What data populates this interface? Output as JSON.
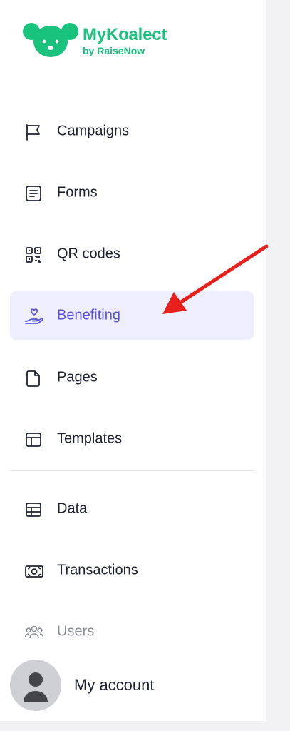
{
  "brand": {
    "name": "MyKoalect",
    "tagline": "by RaiseNow",
    "color": "#19c37d"
  },
  "nav": {
    "items": [
      {
        "label": "Campaigns",
        "icon": "flag-icon"
      },
      {
        "label": "Forms",
        "icon": "form-icon"
      },
      {
        "label": "QR codes",
        "icon": "qr-code-icon"
      },
      {
        "label": "Benefiting",
        "icon": "hand-heart-icon",
        "active": true
      },
      {
        "label": "Pages",
        "icon": "page-icon"
      },
      {
        "label": "Templates",
        "icon": "template-icon"
      },
      {
        "label": "Data",
        "icon": "table-icon"
      },
      {
        "label": "Transactions",
        "icon": "money-icon"
      },
      {
        "label": "Users",
        "icon": "users-icon"
      }
    ],
    "active_color": "#5b54e0",
    "active_bg": "#efeefd"
  },
  "account": {
    "label": "My account",
    "icon": "user-avatar-icon"
  },
  "annotation": {
    "arrow_color": "#e8201c",
    "points_to": "Benefiting"
  }
}
